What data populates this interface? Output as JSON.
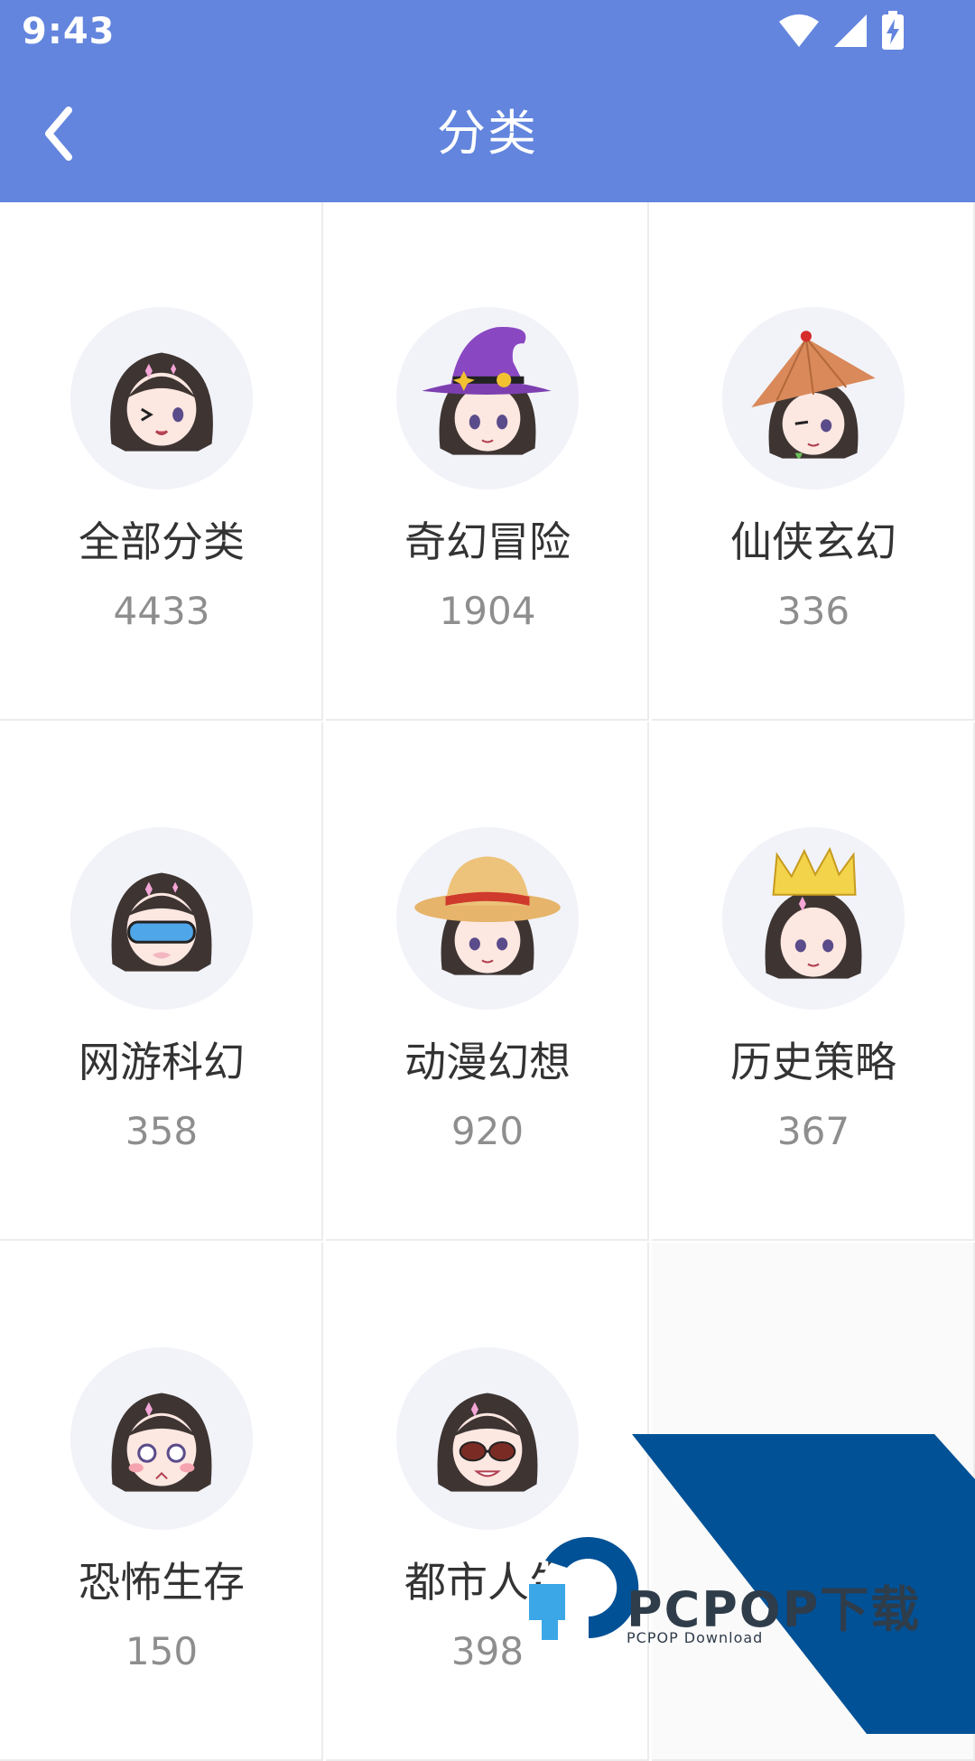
{
  "status_bar": {
    "time": "9:43",
    "icons": [
      "wifi-icon",
      "signal-icon",
      "battery-charging-icon"
    ]
  },
  "header": {
    "title": "分类",
    "back_icon": "chevron-left-icon"
  },
  "colors": {
    "app_bar": "#6385de",
    "title_text": "#ffffff",
    "category_name": "#333333",
    "category_count": "#8e8e8e",
    "avatar_bg": "#f2f3f9",
    "watermark_blue": "#005196"
  },
  "categories": [
    {
      "name": "全部分类",
      "count": "4433",
      "avatar": "girl-winking"
    },
    {
      "name": "奇幻冒险",
      "count": "1904",
      "avatar": "girl-witch-hat"
    },
    {
      "name": "仙侠玄幻",
      "count": "336",
      "avatar": "girl-straw-conical-hat"
    },
    {
      "name": "网游科幻",
      "count": "358",
      "avatar": "girl-goggles"
    },
    {
      "name": "动漫幻想",
      "count": "920",
      "avatar": "girl-straw-hat"
    },
    {
      "name": "历史策略",
      "count": "367",
      "avatar": "girl-crown"
    },
    {
      "name": "恐怖生存",
      "count": "150",
      "avatar": "girl-scared"
    },
    {
      "name": "都市人生",
      "count": "398",
      "avatar": "girl-sunglasses"
    }
  ],
  "watermark": {
    "logo_text": "PCPOP下载",
    "sub_text": "PCPOP Download"
  }
}
